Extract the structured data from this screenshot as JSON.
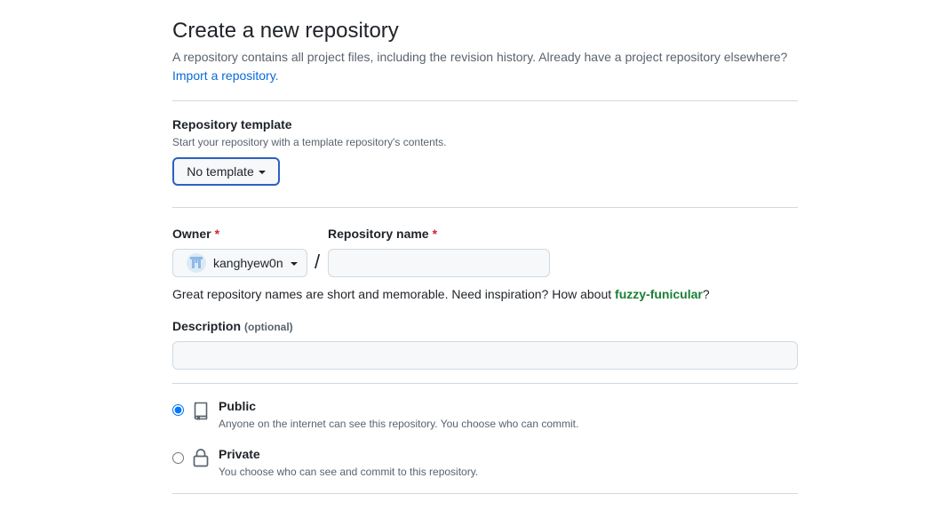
{
  "header": {
    "title": "Create a new repository",
    "subtitle": "A repository contains all project files, including the revision history. Already have a project repository elsewhere?",
    "import_link": "Import a repository.",
    "import_link_text": "Import a repository",
    "import_period": "."
  },
  "template": {
    "label": "Repository template",
    "note": "Start your repository with a template repository's contents.",
    "button_label": "No template"
  },
  "owner": {
    "label": "Owner",
    "required_mark": "*",
    "username": "kanghyew0n"
  },
  "repo_name": {
    "label": "Repository name",
    "required_mark": "*",
    "value": "",
    "separator": "/"
  },
  "hint": {
    "text": "Great repository names are short and memorable. Need inspiration? How about ",
    "suggestion": "fuzzy-funicular",
    "end": "?"
  },
  "description": {
    "label": "Description",
    "optional": "(optional)",
    "value": ""
  },
  "visibility": {
    "selected": "public",
    "options": [
      {
        "id": "public",
        "title": "Public",
        "description": "Anyone on the internet can see this repository. You choose who can commit.",
        "icon": "repo-icon"
      },
      {
        "id": "private",
        "title": "Private",
        "description": "You choose who can see and commit to this repository.",
        "icon": "lock-icon"
      }
    ]
  },
  "colors": {
    "link": "#0969da",
    "required": "#d1242f",
    "suggestion": "#1a7f37",
    "focus_border": "#2f5fc4",
    "divider": "#d1d9e0"
  }
}
